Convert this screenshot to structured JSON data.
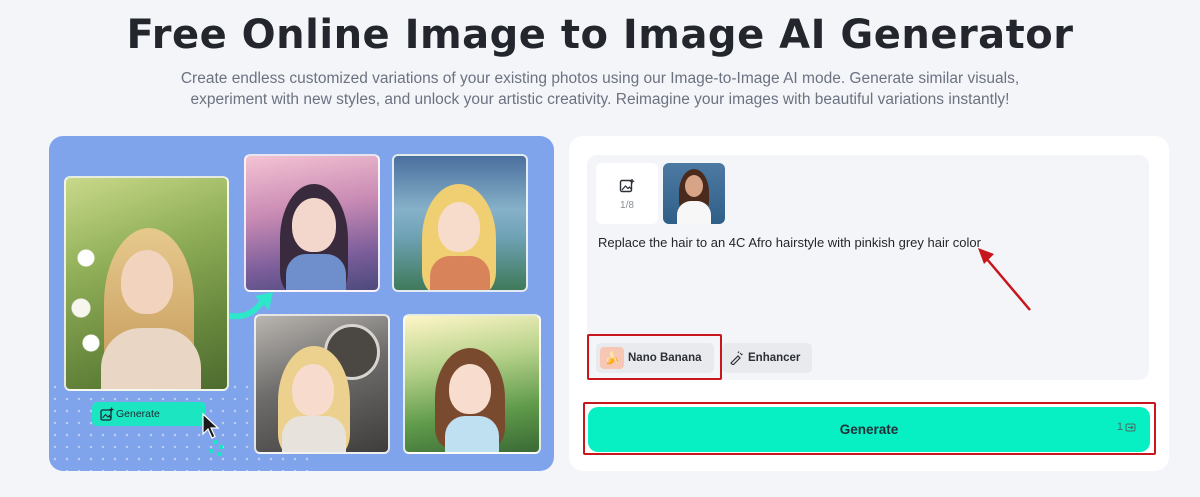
{
  "header": {
    "title": "Free Online Image to Image AI Generator",
    "subtitle": "Create endless customized variations of your existing photos using our Image-to-Image AI mode. Generate similar visuals, experiment with new styles, and unlock your artistic creativity. Reimagine your images with beautiful variations instantly!"
  },
  "showcase": {
    "demo_button_label": "Generate",
    "icons": [
      "image-add-icon",
      "cursor-icon",
      "arrow-icon"
    ]
  },
  "editor": {
    "upload": {
      "count": "1/8",
      "icon": "image-upload-icon"
    },
    "prompt_text": "Replace the hair to an 4C Afro hairstyle with pinkish grey hair color",
    "model_chip_label": "Nano Banana",
    "enhancer_chip_label": "Enhancer",
    "generate_label": "Generate",
    "credit_value": "1",
    "accent_color": "#07f0c4",
    "highlight_color": "#c8161d"
  }
}
